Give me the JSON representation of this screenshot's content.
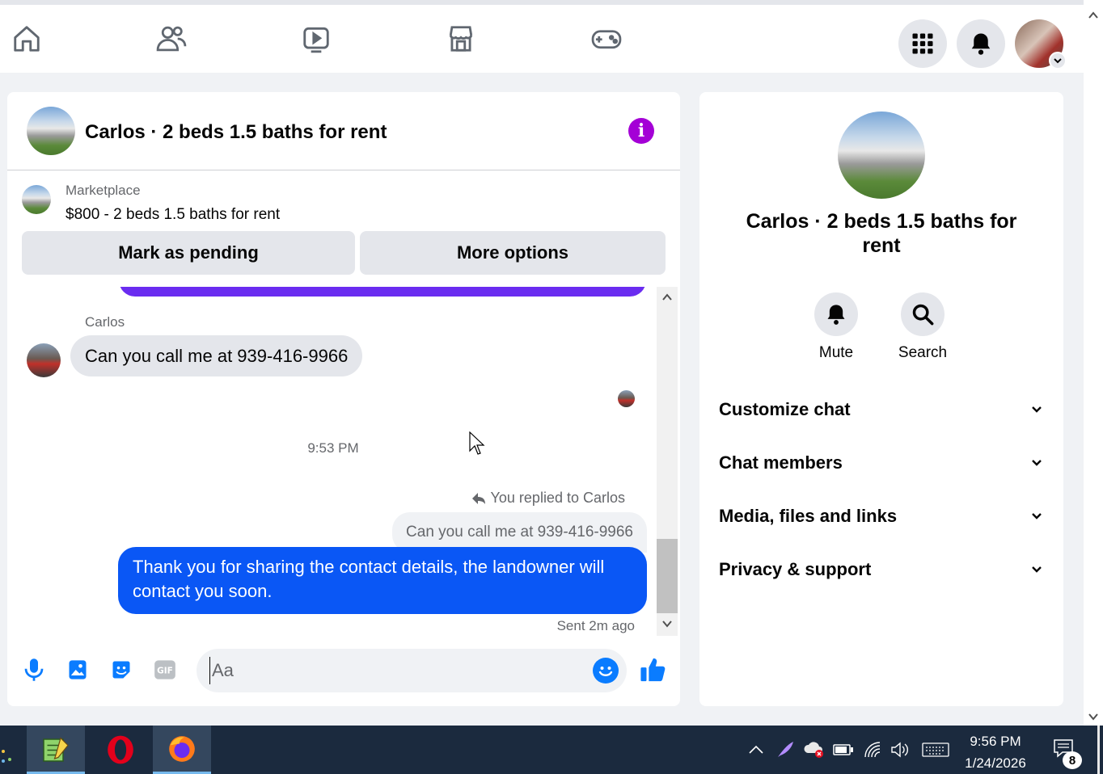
{
  "nav": {
    "icons": [
      "home-icon",
      "friends-icon",
      "watch-icon",
      "marketplace-icon",
      "gaming-icon"
    ],
    "right": [
      "menu-grid-icon",
      "notifications-icon",
      "account-avatar"
    ]
  },
  "conversation": {
    "title": "Carlos · 2 beds 1.5 baths for rent",
    "marketplace_label": "Marketplace",
    "listing": "$800 - 2 beds 1.5 baths for rent",
    "mark_pending_label": "Mark as pending",
    "more_options_label": "More options",
    "messages": {
      "sender_name": "Carlos",
      "incoming_text": "Can you  call me at 939-416-9966",
      "timestamp": "9:53 PM",
      "replied_label": "You replied to Carlos",
      "quoted_text": "Can you  call me at 939-416-9966",
      "outgoing_text": "Thank you for sharing the contact details, the landowner will contact you soon.",
      "sent_status": "Sent 2m ago"
    },
    "composer": {
      "placeholder": "Aa"
    }
  },
  "info_panel": {
    "title": "Carlos · 2 beds 1.5 baths for rent",
    "mute_label": "Mute",
    "search_label": "Search",
    "sections": [
      "Customize chat",
      "Chat members",
      "Media, files and links",
      "Privacy & support"
    ]
  },
  "taskbar": {
    "time": "9:56 PM",
    "date": "1/24/2026",
    "notification_count": "8"
  },
  "colors": {
    "accent_blue": "#0a57f5",
    "info_purple": "#a400d6",
    "taskbar": "#1b2a3e"
  }
}
